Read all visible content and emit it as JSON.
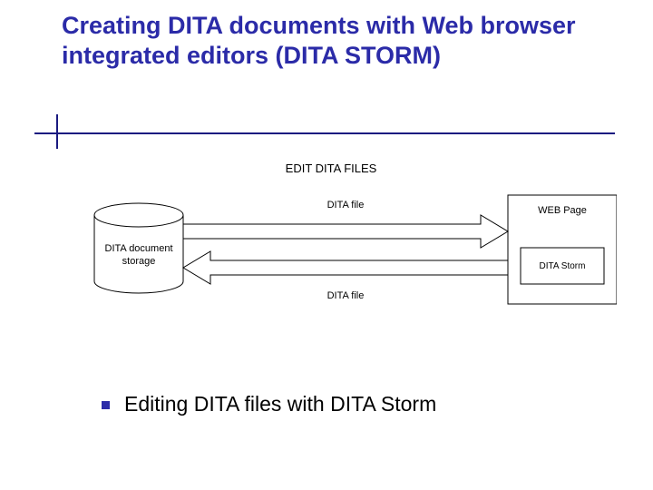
{
  "slide": {
    "title": "Creating DITA documents with Web browser integrated editors (DITA STORM)",
    "bullet": "Editing DITA files with DITA Storm"
  },
  "diagram": {
    "heading": "EDIT DITA FILES",
    "left_label_line1": "DITA document",
    "left_label_line2": "storage",
    "top_arrow_label": "DITA file",
    "bottom_arrow_label": "DITA file",
    "right_outer_label": "WEB Page",
    "right_inner_label": "DITA Storm"
  }
}
